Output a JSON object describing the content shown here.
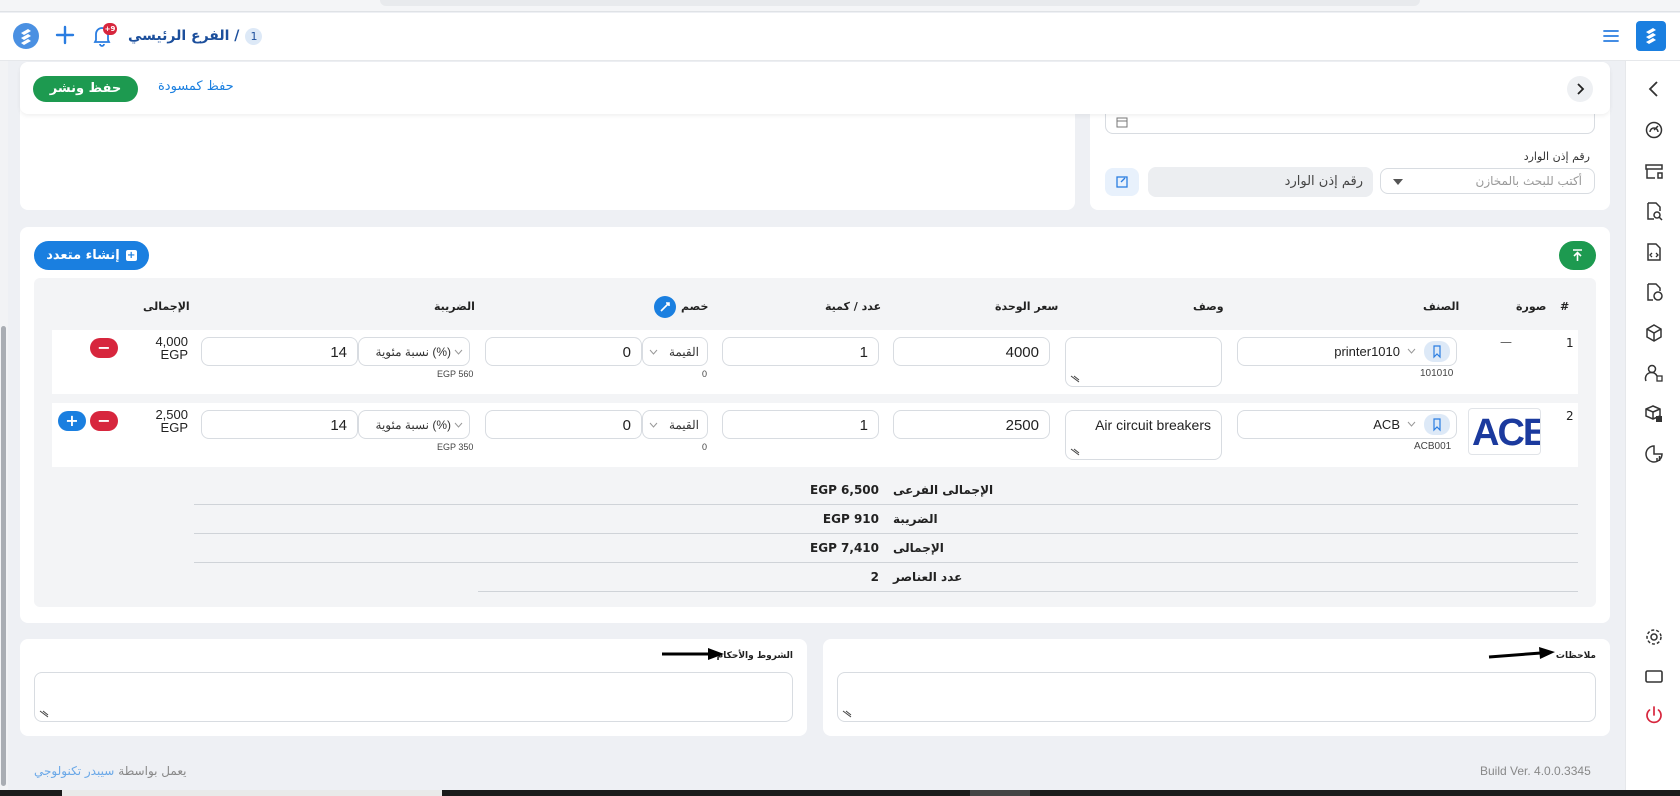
{
  "header": {
    "branch_label": "الفرع الرئيسي /",
    "branch_count": "1",
    "notification_count": "+9"
  },
  "actions": {
    "save_publish": "حفظ ونشر",
    "save_draft": "حفظ كمسودة"
  },
  "receipt": {
    "label": "رقم إذن الوارد",
    "search_placeholder": "أكتب للبحث بالمخازن",
    "number_placeholder": "رقم إذن الوارد"
  },
  "table": {
    "create_multiple": "إنشاء متعدد",
    "columns": {
      "num": "#",
      "image": "صورة",
      "item": "الصنف",
      "description": "وصف",
      "unit_price": "سعر الوحدة",
      "qty": "عدد / كمية",
      "discount": "خصم",
      "tax": "الضريبة",
      "total": "الإجمالى"
    },
    "rows": [
      {
        "num": "1",
        "image_placeholder": "—",
        "item": "printer1010",
        "code": "101010",
        "description": "",
        "unit_price": "4000",
        "qty": "1",
        "discount_type": "القيمة",
        "discount": "0",
        "discount_note": "0",
        "tax_type": "نسبة مئوية (%)",
        "tax": "14",
        "tax_note": "EGP 560",
        "total_amount": "4,000",
        "total_currency": "EGP"
      },
      {
        "num": "2",
        "image_text": "ACE",
        "item": "ACB",
        "code": "ACB001",
        "description": "Air circuit breakers",
        "unit_price": "2500",
        "qty": "1",
        "discount_type": "القيمة",
        "discount": "0",
        "discount_note": "0",
        "tax_type": "نسبة مئوية (%)",
        "tax": "14",
        "tax_note": "EGP 350",
        "total_amount": "2,500",
        "total_currency": "EGP"
      }
    ],
    "summary": [
      {
        "label": "الإجمالى الفرعى",
        "value": "EGP 6,500"
      },
      {
        "label": "الضريبة",
        "value": "EGP 910"
      },
      {
        "label": "الإجمالى",
        "value": "EGP 7,410"
      },
      {
        "label": "عدد العناصر",
        "value": "2"
      }
    ]
  },
  "notes": {
    "notes_label": "ملاحظات",
    "terms_label": "الشروط والأحكام"
  },
  "footer": {
    "build": "Build Ver. 4.0.0.3345",
    "powered_prefix": "يعمل بواسطة",
    "powered_link": "سيبدر تكنولوجي"
  },
  "colors": {
    "primary": "#1a7fe0",
    "success": "#1d9a50",
    "danger": "#d7263d",
    "ace_logo": "#1b3a9e"
  },
  "icons": {
    "sidebar": [
      "chevron-left-icon",
      "dashboard-icon",
      "store-icon",
      "search-doc-icon",
      "code-doc-icon",
      "money-doc-icon",
      "box-icon",
      "users-icon",
      "package-icon",
      "report-icon",
      "settings-icon",
      "screen-icon",
      "power-icon"
    ]
  }
}
